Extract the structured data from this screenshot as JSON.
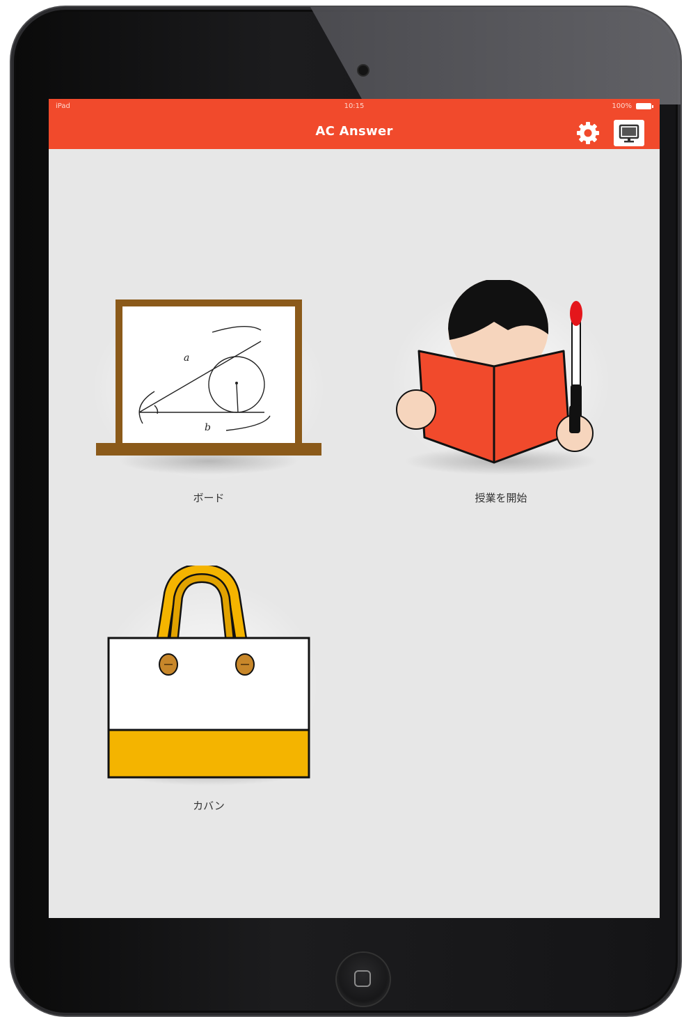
{
  "status_bar": {
    "carrier": "iPad",
    "time": "10:15",
    "battery": "100%"
  },
  "nav": {
    "title": "AC Answer",
    "settings_icon": "gear-icon",
    "display_icon": "monitor-icon"
  },
  "tiles": [
    {
      "label": "ボード",
      "icon": "blackboard-icon",
      "board_labels": {
        "a": "a",
        "b": "b"
      }
    },
    {
      "label": "授業を開始",
      "icon": "reading-teacher-icon"
    },
    {
      "label": "カバン",
      "icon": "bag-icon"
    }
  ],
  "colors": {
    "accent": "#f14a2c",
    "board_frame": "#8b5a1a",
    "bag_yellow": "#f4b400"
  }
}
